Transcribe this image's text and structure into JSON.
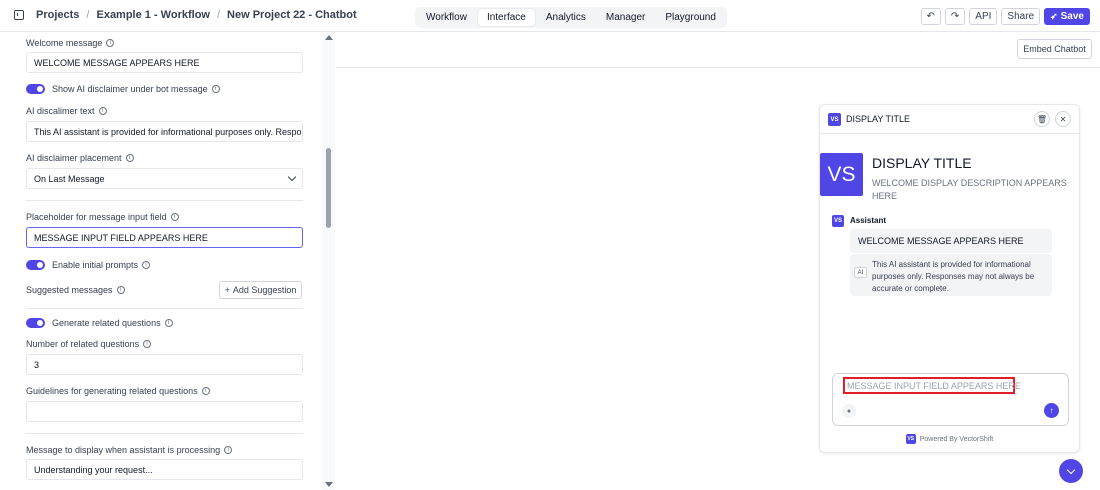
{
  "breadcrumb": [
    "Projects",
    "Example 1 - Workflow",
    "New Project 22 - Chatbot"
  ],
  "tabs": [
    {
      "label": "Workflow",
      "active": false
    },
    {
      "label": "Interface",
      "active": true
    },
    {
      "label": "Analytics",
      "active": false
    },
    {
      "label": "Manager",
      "active": false
    },
    {
      "label": "Playground",
      "active": false
    }
  ],
  "toolbar": {
    "undo": "↶",
    "redo": "↷",
    "api": "API",
    "share": "Share",
    "save": "Save"
  },
  "settings": {
    "welcome_label": "Welcome message",
    "welcome_value": "WELCOME MESSAGE APPEARS HERE",
    "show_disclaimer_label": "Show AI disclaimer under bot message",
    "disclaimer_text_label": "AI discalimer text",
    "disclaimer_text_value": "This AI assistant is provided for informational purposes only. Responses may not always be accurate or complete.",
    "placement_label": "AI disclaimer placement",
    "placement_value": "On Last Message",
    "placeholder_label": "Placeholder for message input field",
    "placeholder_value": "MESSAGE INPUT FIELD APPEARS HERE",
    "initial_prompts_label": "Enable initial prompts",
    "suggested_label": "Suggested messages",
    "add_suggestion_label": "Add Suggestion",
    "related_label": "Generate related questions",
    "num_related_label": "Number of related questions",
    "num_related_value": "3",
    "guidelines_label": "Guidelines for generating related questions",
    "guidelines_value": "",
    "processing_label": "Message to display when assistant is processing",
    "processing_value": "Understanding your request..."
  },
  "canvas": {
    "embed_label": "Embed Chatbot"
  },
  "chat": {
    "header_logo": "VS",
    "header_title": "DISPLAY TITLE",
    "big_logo": "VS",
    "title": "DISPLAY TITLE",
    "description": "WELCOME DISPLAY DESCRIPTION APPEARS HERE",
    "assistant_logo": "VS",
    "assistant_name": "Assistant",
    "welcome_message": "WELCOME MESSAGE APPEARS HERE",
    "ai_badge": "AI",
    "disclaimer": "This AI assistant is provided for informational purposes only. Responses may not always be accurate or complete.",
    "input_placeholder": "MESSAGE INPUT FIELD APPEARS HERE",
    "powered_logo": "VS",
    "powered_by": "Powered By VectorShift"
  },
  "colors": {
    "accent": "#4f46e5",
    "highlight": "#e11d2a"
  }
}
